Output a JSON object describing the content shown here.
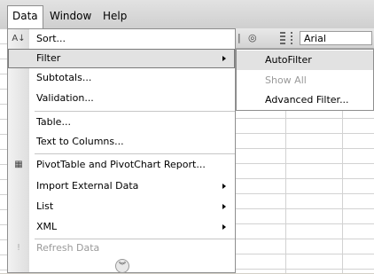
{
  "menubar": {
    "items": [
      "Data",
      "Window",
      "Help"
    ]
  },
  "toolbar": {
    "font_value": "Arial"
  },
  "data_menu": {
    "items": [
      {
        "label": "Sort..."
      },
      {
        "label": "Filter"
      },
      {
        "label": "Subtotals..."
      },
      {
        "label": "Validation..."
      },
      {
        "label": "Table..."
      },
      {
        "label": "Text to Columns..."
      },
      {
        "label": "PivotTable and PivotChart Report..."
      },
      {
        "label": "Import External Data"
      },
      {
        "label": "List"
      },
      {
        "label": "XML"
      },
      {
        "label": "Refresh Data"
      }
    ]
  },
  "filter_submenu": {
    "items": [
      {
        "label": "AutoFilter"
      },
      {
        "label": "Show All"
      },
      {
        "label": "Advanced Filter..."
      }
    ]
  },
  "icons": {
    "sort": "sort-ascending-icon",
    "pivot": "pivot-table-icon",
    "refresh": "refresh-icon",
    "expand": "chevron-double-down-icon"
  }
}
